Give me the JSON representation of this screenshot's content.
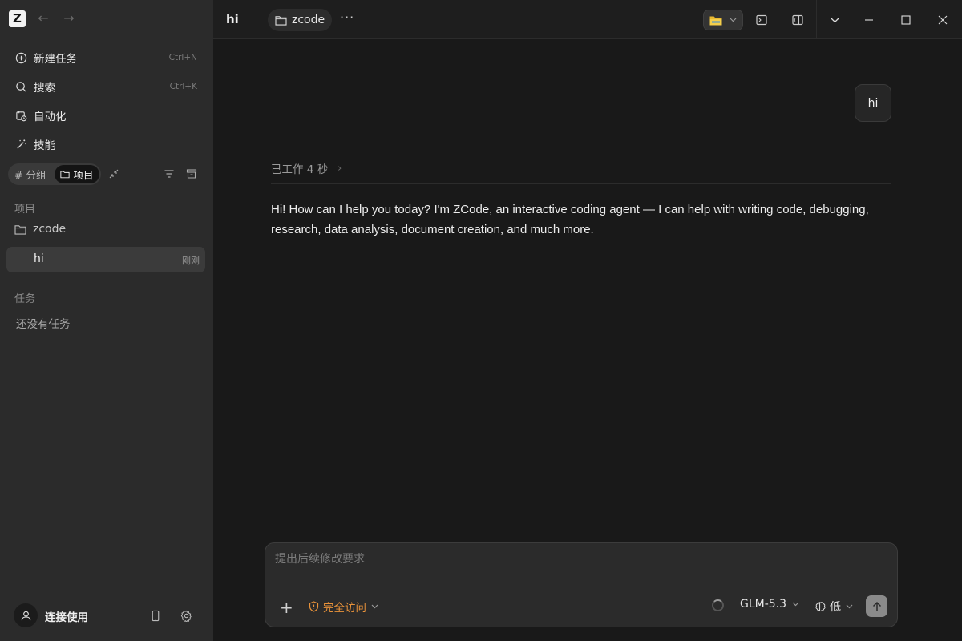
{
  "app": {
    "logo_letter": "Z"
  },
  "sidebar": {
    "menu": [
      {
        "label": "新建任务",
        "shortcut": "Ctrl+N",
        "icon": "plus-circle-icon"
      },
      {
        "label": "搜索",
        "shortcut": "Ctrl+K",
        "icon": "search-icon"
      },
      {
        "label": "自动化",
        "shortcut": "",
        "icon": "calendar-clock-icon"
      },
      {
        "label": "技能",
        "shortcut": "",
        "icon": "wand-icon"
      }
    ],
    "segmented": {
      "group_label": "# 分组",
      "project_label": "项目",
      "selected": "项目"
    },
    "projects_title": "项目",
    "project_name": "zcode",
    "chat": {
      "title": "hi",
      "time": "刚刚"
    },
    "tasks_title": "任务",
    "tasks_empty": "还没有任务",
    "user_label": "连接使用"
  },
  "header": {
    "title": "hi",
    "project_chip": "zcode",
    "more_label": "···"
  },
  "conversation": {
    "user_message": "hi",
    "worked_label": "已工作 4 秒",
    "assistant_message": "Hi! How can I help you today? I'm ZCode, an interactive coding agent — I can help with writing code, debugging, research, data analysis, document creation, and much more."
  },
  "composer": {
    "placeholder": "提出后续修改要求",
    "access_label": "完全访问",
    "model": "GLM-5.3",
    "effort": "低"
  },
  "colors": {
    "accent_orange": "#e8923a",
    "sidebar_bg": "#2b2b2b",
    "main_bg": "#191919"
  }
}
